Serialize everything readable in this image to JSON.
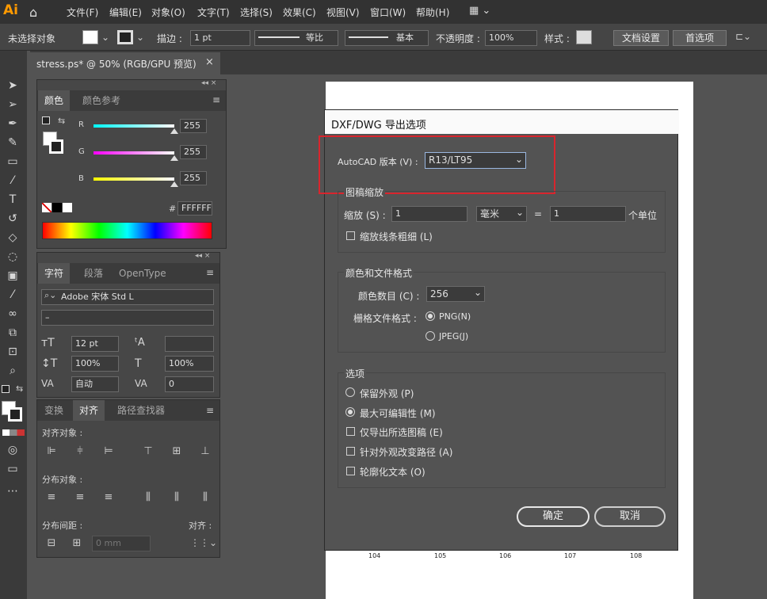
{
  "app": {
    "logo": "Ai",
    "menus": [
      "文件(F)",
      "编辑(E)",
      "对象(O)",
      "文字(T)",
      "选择(S)",
      "效果(C)",
      "视图(V)",
      "窗口(W)",
      "帮助(H)"
    ]
  },
  "control": {
    "no_selection": "未选择对象",
    "stroke_label": "描边 :",
    "stroke_value": "1 pt",
    "profile1": "等比",
    "profile2": "基本",
    "opacity_label": "不透明度 :",
    "opacity_value": "100%",
    "style_label": "样式 :",
    "doc_settings": "文档设置",
    "preferences": "首选项"
  },
  "document": {
    "tab_title": "stress.ps* @ 50% (RGB/GPU 预览)",
    "close": "×",
    "page_numbers": [
      "104",
      "105",
      "106",
      "107",
      "108"
    ]
  },
  "color_panel": {
    "tabs": [
      "颜色",
      "颜色参考"
    ],
    "r_label": "R",
    "g_label": "G",
    "b_label": "B",
    "r": "255",
    "g": "255",
    "b": "255",
    "hex_label": "#",
    "hex": "FFFFFF"
  },
  "char_panel": {
    "tabs": [
      "字符",
      "段落",
      "OpenType"
    ],
    "font": "Adobe 宋体 Std L",
    "style": "–",
    "size": "12 pt",
    "leading": "",
    "vscale": "100%",
    "hscale": "100%",
    "kerning": "自动",
    "tracking": "0"
  },
  "align_panel": {
    "tabs": [
      "变换",
      "对齐",
      "路径查找器"
    ],
    "align_objects": "对齐对象 :",
    "distribute_objects": "分布对象 :",
    "distribute_spacing": "分布间距 :",
    "align_to": "对齐 :",
    "spacing_value": "0 mm"
  },
  "dialog": {
    "title": "DXF/DWG 导出选项",
    "autocad_label": "AutoCAD 版本 (V) :",
    "autocad_value": "R13/LT95",
    "scale_group": "图稿缩放",
    "scale_label": "缩放 (S) :",
    "scale_value": "1",
    "unit": "毫米",
    "eq": "=",
    "units_value": "1",
    "units_label": "个单位",
    "scale_lines": "缩放线条粗细 (L)",
    "color_group": "颜色和文件格式",
    "color_count_label": "颜色数目 (C) :",
    "color_count": "256",
    "raster_label": "栅格文件格式 :",
    "png": "PNG(N)",
    "jpeg": "JPEG(J)",
    "options_group": "选项",
    "preserve": "保留外观 (P)",
    "max_edit": "最大可编辑性 (M)",
    "export_selected": "仅导出所选图稿 (E)",
    "alter_paths": "针对外观改变路径 (A)",
    "outline_text": "轮廓化文本 (O)",
    "ok": "确定",
    "cancel": "取消"
  },
  "colors": {
    "highlight": "#d9252d"
  }
}
